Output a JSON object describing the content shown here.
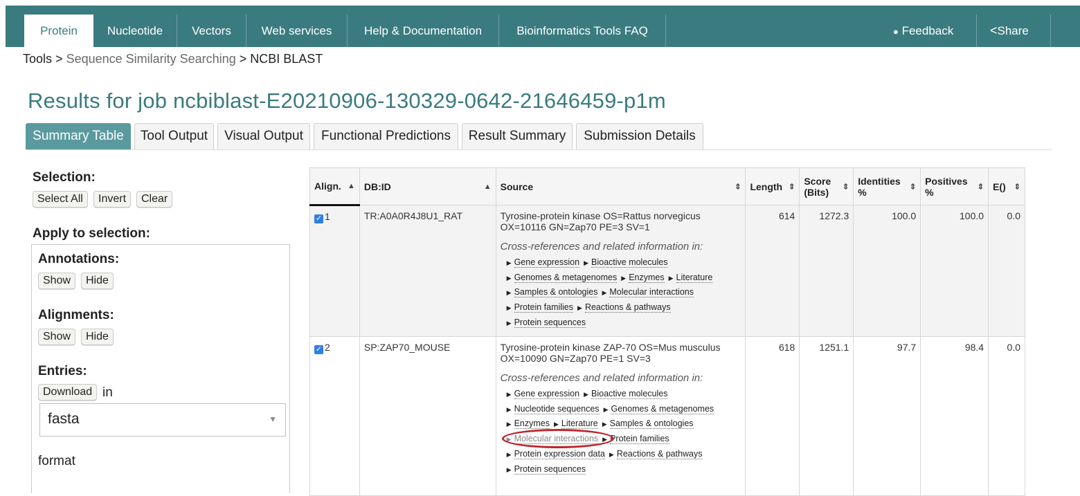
{
  "nav": {
    "tabs": [
      "Protein",
      "Nucleotide",
      "Vectors",
      "Web services",
      "Help & Documentation",
      "Bioinformatics Tools FAQ"
    ],
    "feedback": "Feedback",
    "share": "Share"
  },
  "breadcrumb": {
    "root": "Tools",
    "sep1": ">",
    "middle": "Sequence Similarity Searching",
    "sep2": ">",
    "current": "NCBI BLAST"
  },
  "page_title": "Results for job ncbiblast-E20210906-130329-0642-21646459-p1m",
  "result_tabs": [
    "Summary Table",
    "Tool Output",
    "Visual Output",
    "Functional Predictions",
    "Result Summary",
    "Submission Details"
  ],
  "left": {
    "selection_label": "Selection:",
    "select_all": "Select All",
    "invert": "Invert",
    "clear": "Clear",
    "apply_label": "Apply to selection:",
    "annotations_label": "Annotations:",
    "alignments_label": "Alignments:",
    "show": "Show",
    "hide": "Hide",
    "entries_label": "Entries:",
    "download": "Download",
    "in": "in",
    "format_value": "fasta",
    "format_label": "format"
  },
  "table": {
    "headers": [
      "Align.",
      "DB:ID",
      "Source",
      "Length",
      "Score (Bits)",
      "Identities %",
      "Positives %",
      "E()"
    ],
    "xref_title": "Cross-references and related information in:",
    "rows": [
      {
        "align": "1",
        "dbid": "TR:A0A0R4J8U1_RAT",
        "source": "Tyrosine-protein kinase OS=Rattus norvegicus OX=10116 GN=Zap70 PE=3 SV=1",
        "length": "614",
        "score": "1272.3",
        "identities": "100.0",
        "positives": "100.0",
        "evalue": "0.0",
        "xrefs": [
          [
            "Gene expression",
            "Bioactive molecules"
          ],
          [
            "Genomes & metagenomes",
            "Enzymes",
            "Literature"
          ],
          [
            "Samples & ontologies",
            "Molecular interactions"
          ],
          [
            "Protein families",
            "Reactions & pathways"
          ],
          [
            "Protein sequences"
          ]
        ]
      },
      {
        "align": "2",
        "dbid": "SP:ZAP70_MOUSE",
        "source": "Tyrosine-protein kinase ZAP-70 OS=Mus musculus OX=10090 GN=Zap70 PE=1 SV=3",
        "length": "618",
        "score": "1251.1",
        "identities": "97.7",
        "positives": "98.4",
        "evalue": "0.0",
        "xrefs": [
          [
            "Gene expression",
            "Bioactive molecules"
          ],
          [
            "Nucleotide sequences",
            "Genomes & metagenomes"
          ],
          [
            "Enzymes",
            "Literature",
            "Samples & ontologies"
          ],
          [
            "Molecular interactions",
            "Protein families"
          ],
          [
            "Protein expression data",
            "Reactions & pathways"
          ],
          [
            "Protein sequences"
          ]
        ]
      }
    ]
  },
  "colors": {
    "nav_bg": "#3a7b80",
    "active_tab": "#5a9a9f",
    "annotation": "#c0262d"
  }
}
